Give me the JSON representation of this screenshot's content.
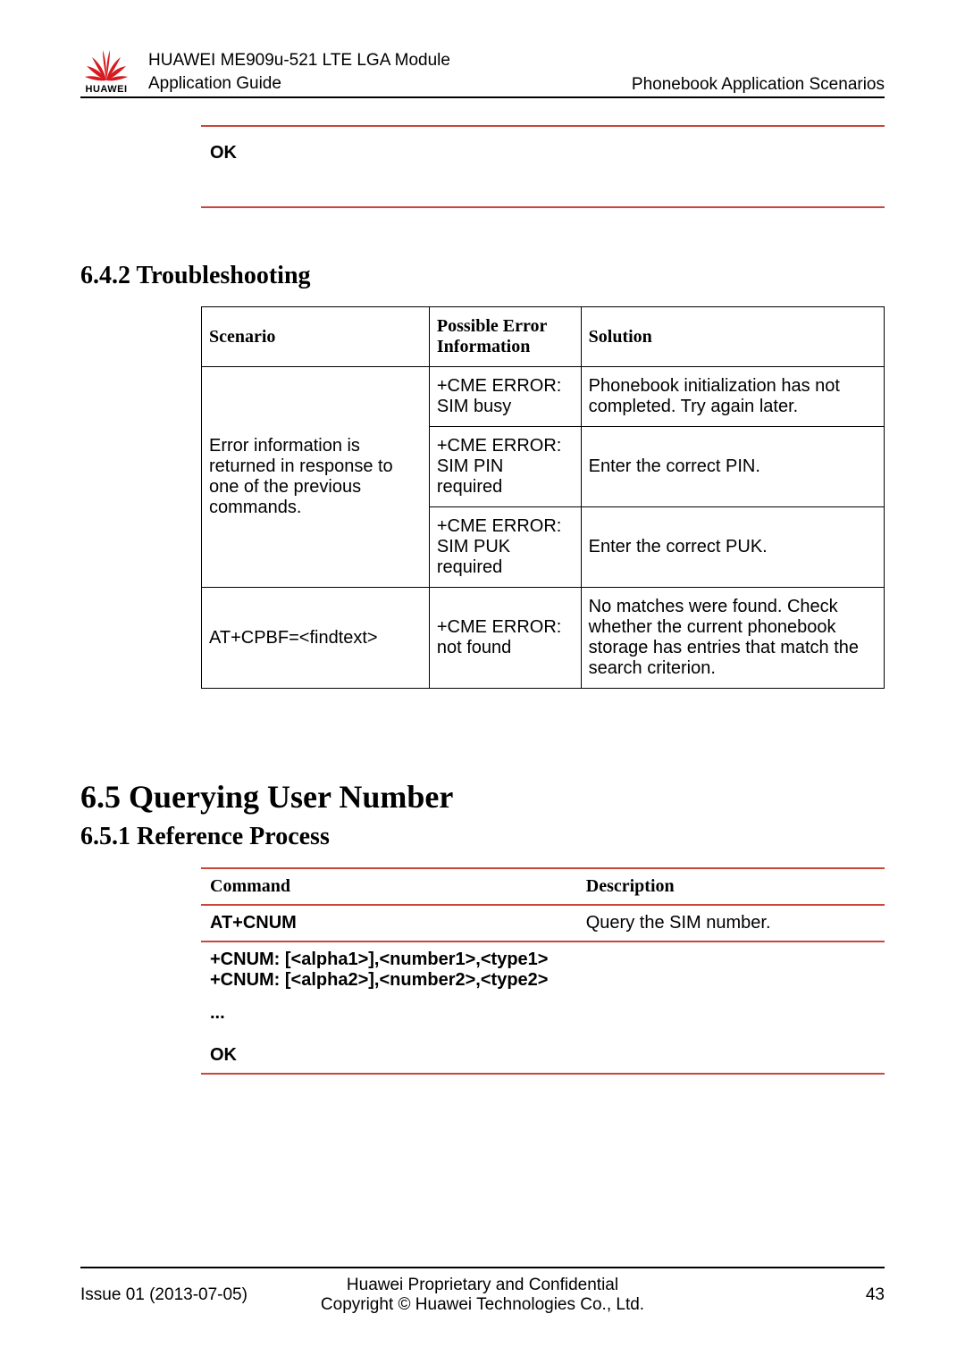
{
  "header": {
    "logo_text": "HUAWEI",
    "title_line1": "HUAWEI ME909u-521 LTE LGA Module",
    "title_line2": "Application Guide",
    "right": "Phonebook Application Scenarios"
  },
  "ok_block": {
    "label": "OK"
  },
  "section_642": {
    "heading": "6.4.2 Troubleshooting",
    "table_headers": {
      "c1": "Scenario",
      "c2": "Possible Error Information",
      "c3": "Solution"
    },
    "rows": {
      "r1": {
        "scenario": "Error information is returned in response to one of the previous commands.",
        "a": {
          "err": "+CME ERROR: SIM busy",
          "sol": "Phonebook initialization has not completed. Try again later."
        },
        "b": {
          "err": "+CME ERROR: SIM PIN required",
          "sol": "Enter the correct PIN."
        },
        "c": {
          "err": "+CME ERROR: SIM PUK required",
          "sol": "Enter the correct PUK."
        }
      },
      "r2": {
        "scenario": "AT+CPBF=<findtext>",
        "err": "+CME ERROR: not found",
        "sol": "No matches were found. Check whether the current phonebook storage has entries that match the search criterion."
      }
    }
  },
  "section_65": {
    "heading": "6.5 Querying User Number"
  },
  "section_651": {
    "heading": "6.5.1 Reference Process",
    "table_headers": {
      "c1": "Command",
      "c2": "Description"
    },
    "row1": {
      "cmd": "AT+CNUM",
      "desc": "Query the SIM number."
    },
    "row2": {
      "line1": "+CNUM: [<alpha1>],<number1>,<type1>",
      "line2": "+CNUM: [<alpha2>],<number2>,<type2>",
      "line3": "...",
      "line4": "OK"
    }
  },
  "footer": {
    "left": "Issue 01 (2013-07-05)",
    "center_line1": "Huawei Proprietary and Confidential",
    "center_line2": "Copyright © Huawei Technologies Co., Ltd.",
    "right": "43"
  }
}
